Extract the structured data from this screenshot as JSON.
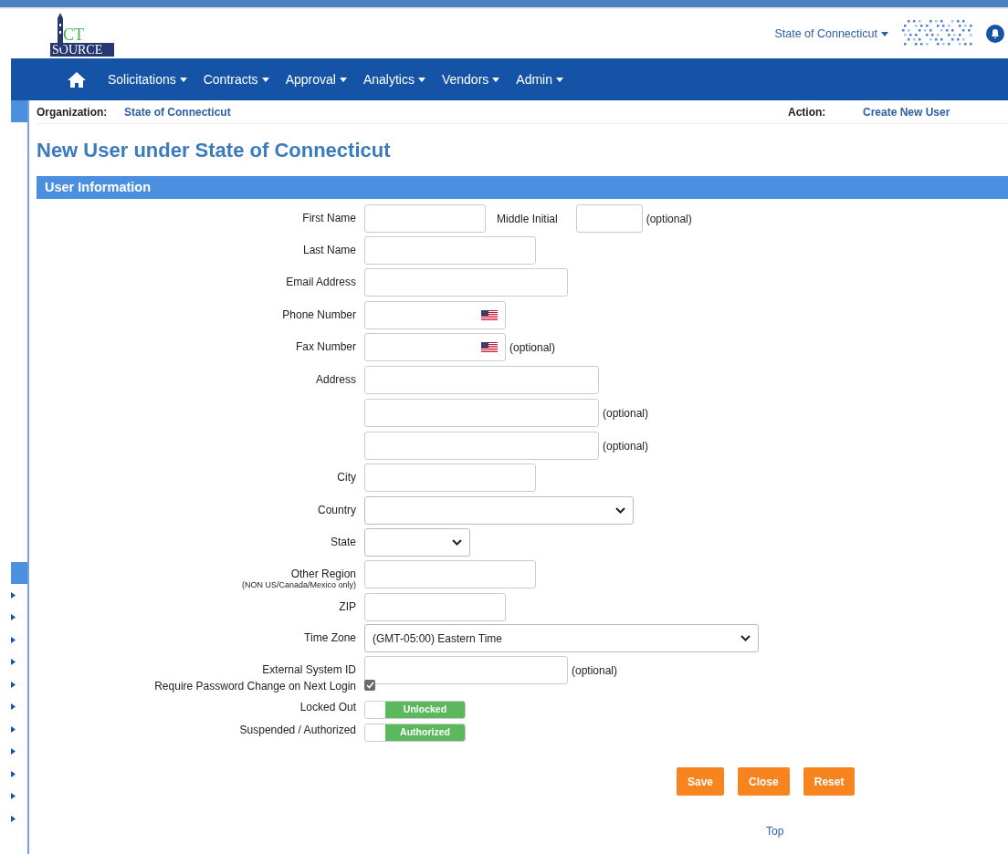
{
  "logo": {
    "top": "CT",
    "bottom": "SOURCE"
  },
  "header": {
    "org_menu": "State of Connecticut"
  },
  "nav": [
    "Solicitations",
    "Contracts",
    "Approval",
    "Analytics",
    "Vendors",
    "Admin"
  ],
  "context": {
    "org_label": "Organization:",
    "org_value": "State of Connecticut",
    "action_label": "Action:",
    "action_value": "Create New User"
  },
  "title": "New User under State of Connecticut",
  "section": "User Information",
  "rows": [
    {
      "label": "First Name",
      "fields": [
        {
          "kind": "text"
        }
      ],
      "extra": {
        "label": "Middle Initial",
        "note": "(optional)"
      }
    },
    {
      "label": "Last Name",
      "fields": [
        {
          "kind": "text"
        }
      ]
    },
    {
      "label": "Email Address",
      "fields": [
        {
          "kind": "text"
        }
      ]
    },
    {
      "label": "Phone Number",
      "fields": [
        {
          "kind": "phone"
        }
      ]
    },
    {
      "label": "Fax Number",
      "fields": [
        {
          "kind": "phone"
        }
      ],
      "note": "(optional)"
    },
    {
      "label": "Address",
      "fields": [
        {
          "kind": "text"
        }
      ]
    },
    {
      "fields": [
        {
          "kind": "text"
        }
      ],
      "note": "(optional)"
    },
    {
      "fields": [
        {
          "kind": "text"
        }
      ],
      "note": "(optional)"
    },
    {
      "label": "City",
      "fields": [
        {
          "kind": "text"
        }
      ]
    },
    {
      "label": "Country",
      "fields": [
        {
          "kind": "select"
        }
      ]
    },
    {
      "label": "State",
      "fields": [
        {
          "kind": "select"
        }
      ]
    },
    {
      "label": "Other Region",
      "sublabel": "(NON US/Canada/Mexico only)",
      "fields": [
        {
          "kind": "text"
        }
      ]
    },
    {
      "label": "ZIP",
      "fields": [
        {
          "kind": "text"
        }
      ]
    },
    {
      "label": "Time Zone",
      "fields": [
        {
          "kind": "select",
          "value": "(GMT-05:00) Eastern Time"
        }
      ]
    },
    {
      "label": "External System ID",
      "fields": [
        {
          "kind": "text"
        }
      ],
      "note": "(optional)"
    },
    {
      "label": "Require Password Change on Next Login",
      "fields": [
        {
          "kind": "checkbox",
          "checked": true
        }
      ]
    },
    {
      "label": "Locked Out",
      "fields": [
        {
          "kind": "toggle",
          "on": true,
          "text": "Unlocked"
        }
      ]
    },
    {
      "label": "Suspended / Authorized",
      "fields": [
        {
          "kind": "toggle",
          "on": true,
          "text": "Authorized"
        }
      ]
    }
  ],
  "buttons": [
    "Save",
    "Close",
    "Reset"
  ],
  "footer_link": "Top"
}
